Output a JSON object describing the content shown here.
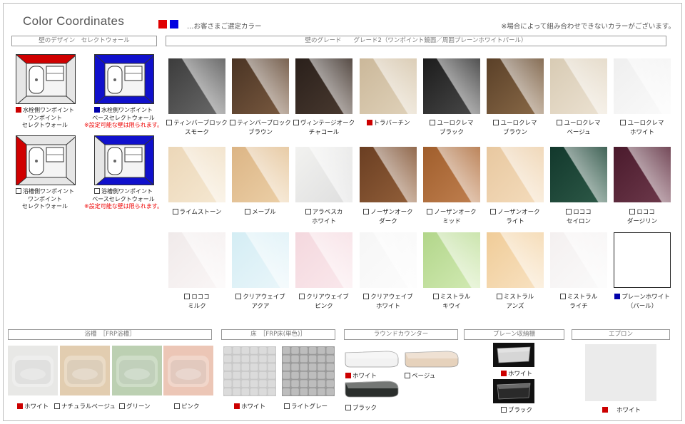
{
  "title": "Color Coordinates",
  "legend_text": "…お客さまご選定カラー",
  "legend_colors": [
    "#e00000",
    "#0000e0"
  ],
  "note": "※場合によって組み合わせできないカラーがございます。",
  "wall_design": {
    "header": "壁のデザイン　セレクトウォール",
    "items": [
      {
        "lines": [
          "水栓側ワンポイント",
          "ワンポイント",
          "セレクトウォール"
        ],
        "check": "red"
      },
      {
        "lines": [
          "水栓側ワンポイント",
          "ベースセレクトウォール"
        ],
        "check": "blue",
        "warning": "※設定可能な壁は限られます。"
      },
      {
        "lines": [
          "浴槽側ワンポイント",
          "ワンポイント",
          "セレクトウォール"
        ],
        "check": "none"
      },
      {
        "lines": [
          "浴槽側ワンポイント",
          "ベースセレクトウォール"
        ],
        "check": "none",
        "warning": "※設定可能な壁は限られます。"
      }
    ]
  },
  "grade": {
    "header": "壁のグレード　　グレード2（ワンポイント鏡面／周囲プレーンホワイトパール）",
    "items": [
      {
        "l1": "ティンバーブロック",
        "l2": "スモーク",
        "color": "#3c3c3c",
        "c2": "#6a6a6a",
        "check": "none"
      },
      {
        "l1": "ティンバーブロック",
        "l2": "ブラウン",
        "color": "#4a3424",
        "c2": "#7a5a40",
        "check": "none"
      },
      {
        "l1": "ヴィンテージオーク",
        "l2": "チャコール",
        "color": "#2a201b",
        "c2": "#4a3a30",
        "check": "none"
      },
      {
        "l1": "トラバーチン",
        "l2": "",
        "color": "#cbb89a",
        "c2": "#e0d2ba",
        "check": "red"
      },
      {
        "l1": "ユーロクレマ",
        "l2": "ブラック",
        "color": "#1c1c1c",
        "c2": "#4a4a4a",
        "check": "none"
      },
      {
        "l1": "ユーロクレマ",
        "l2": "ブラウン",
        "color": "#5a4028",
        "c2": "#8a6a48",
        "check": "none"
      },
      {
        "l1": "ユーロクレマ",
        "l2": "ベージュ",
        "color": "#d8cbb4",
        "c2": "#ece2d2",
        "check": "none"
      },
      {
        "l1": "ユーロクレマ",
        "l2": "ホワイト",
        "color": "#efefef",
        "c2": "#fafafa",
        "check": "none"
      },
      {
        "l1": "ライムストーン",
        "l2": "",
        "color": "#ecd7b8",
        "c2": "#f5e8d2",
        "check": "none"
      },
      {
        "l1": "メープル",
        "l2": "",
        "color": "#dcb585",
        "c2": "#ecd0a8",
        "check": "none"
      },
      {
        "l1": "アラベスカ",
        "l2": "ホワイト",
        "color": "#f2f2f0",
        "c2": "#dedede",
        "check": "none"
      },
      {
        "l1": "ノーザンオーク",
        "l2": "ダーク",
        "color": "#6a3e22",
        "c2": "#93603a",
        "check": "none"
      },
      {
        "l1": "ノーザンオーク",
        "l2": "ミッド",
        "color": "#a05e2c",
        "c2": "#c08050",
        "check": "none"
      },
      {
        "l1": "ノーザンオーク",
        "l2": "ライト",
        "color": "#e8c8a0",
        "c2": "#f4dcbc",
        "check": "none"
      },
      {
        "l1": "ロココ",
        "l2": "セイロン",
        "color": "#12382c",
        "c2": "#2e5a48",
        "check": "none"
      },
      {
        "l1": "ロココ",
        "l2": "ダージリン",
        "color": "#4a1a2c",
        "c2": "#6e3a4c",
        "check": "none"
      },
      {
        "l1": "ロココ",
        "l2": "ミルク",
        "color": "#f0eaea",
        "c2": "#faf6f6",
        "check": "none"
      },
      {
        "l1": "クリアウェイブ",
        "l2": "アクア",
        "color": "#d4edf4",
        "c2": "#eaf6fa",
        "check": "none"
      },
      {
        "l1": "クリアウェイブ",
        "l2": "ピンク",
        "color": "#f4d8de",
        "c2": "#fae8ec",
        "check": "none"
      },
      {
        "l1": "クリアウェイブ",
        "l2": "ホワイト",
        "color": "#f6f6f6",
        "c2": "#fcfcfc",
        "check": "none"
      },
      {
        "l1": "ミストラル",
        "l2": "キウイ",
        "color": "#b2d68a",
        "c2": "#d2eab4",
        "check": "none"
      },
      {
        "l1": "ミストラル",
        "l2": "アンズ",
        "color": "#f0cc98",
        "c2": "#f8e2c2",
        "check": "none"
      },
      {
        "l1": "ミストラル",
        "l2": "ライチ",
        "color": "#f4f0f0",
        "c2": "#fafafa",
        "check": "none"
      },
      {
        "l1": "プレーンホワイト",
        "l2": "（パール）",
        "color": "#ffffff",
        "c2": "#ffffff",
        "check": "blue"
      }
    ]
  },
  "bath": {
    "header": "浴槽　［FRP浴槽］",
    "items": [
      {
        "label": "ホワイト",
        "check": "red",
        "color": "#e8e8e6"
      },
      {
        "label": "ナチュラルベージュ",
        "check": "none",
        "color": "#e2cdb0"
      },
      {
        "label": "グリーン",
        "check": "none",
        "color": "#bcd0b2"
      },
      {
        "label": "ピンク",
        "check": "none",
        "color": "#ecc6b6"
      }
    ]
  },
  "floor": {
    "header": "床　［FRP床(単色)］",
    "items": [
      {
        "label": "ホワイト",
        "check": "red",
        "color": "#c8c8c8"
      },
      {
        "label": "ライトグレー",
        "check": "none",
        "color": "#9a9a9a"
      }
    ]
  },
  "counter": {
    "header": "ラウンドカウンター",
    "items": [
      {
        "label": "ホワイト",
        "check": "red",
        "color": "#f2f2f2"
      },
      {
        "label": "ベージュ",
        "check": "none",
        "color": "#e6d2bc"
      },
      {
        "label": "ブラック",
        "check": "none",
        "color": "#2a2e2c"
      }
    ]
  },
  "shelf": {
    "header": "プレーン収納棚",
    "items": [
      {
        "label": "ホワイト",
        "check": "red",
        "color": "#d6d6d6"
      },
      {
        "label": "ブラック",
        "check": "none",
        "color": "#2a2a2a"
      }
    ]
  },
  "apron": {
    "header": "エプロン",
    "items": [
      {
        "label": "ホワイト",
        "check": "red",
        "color": "#ebebeb"
      }
    ]
  }
}
